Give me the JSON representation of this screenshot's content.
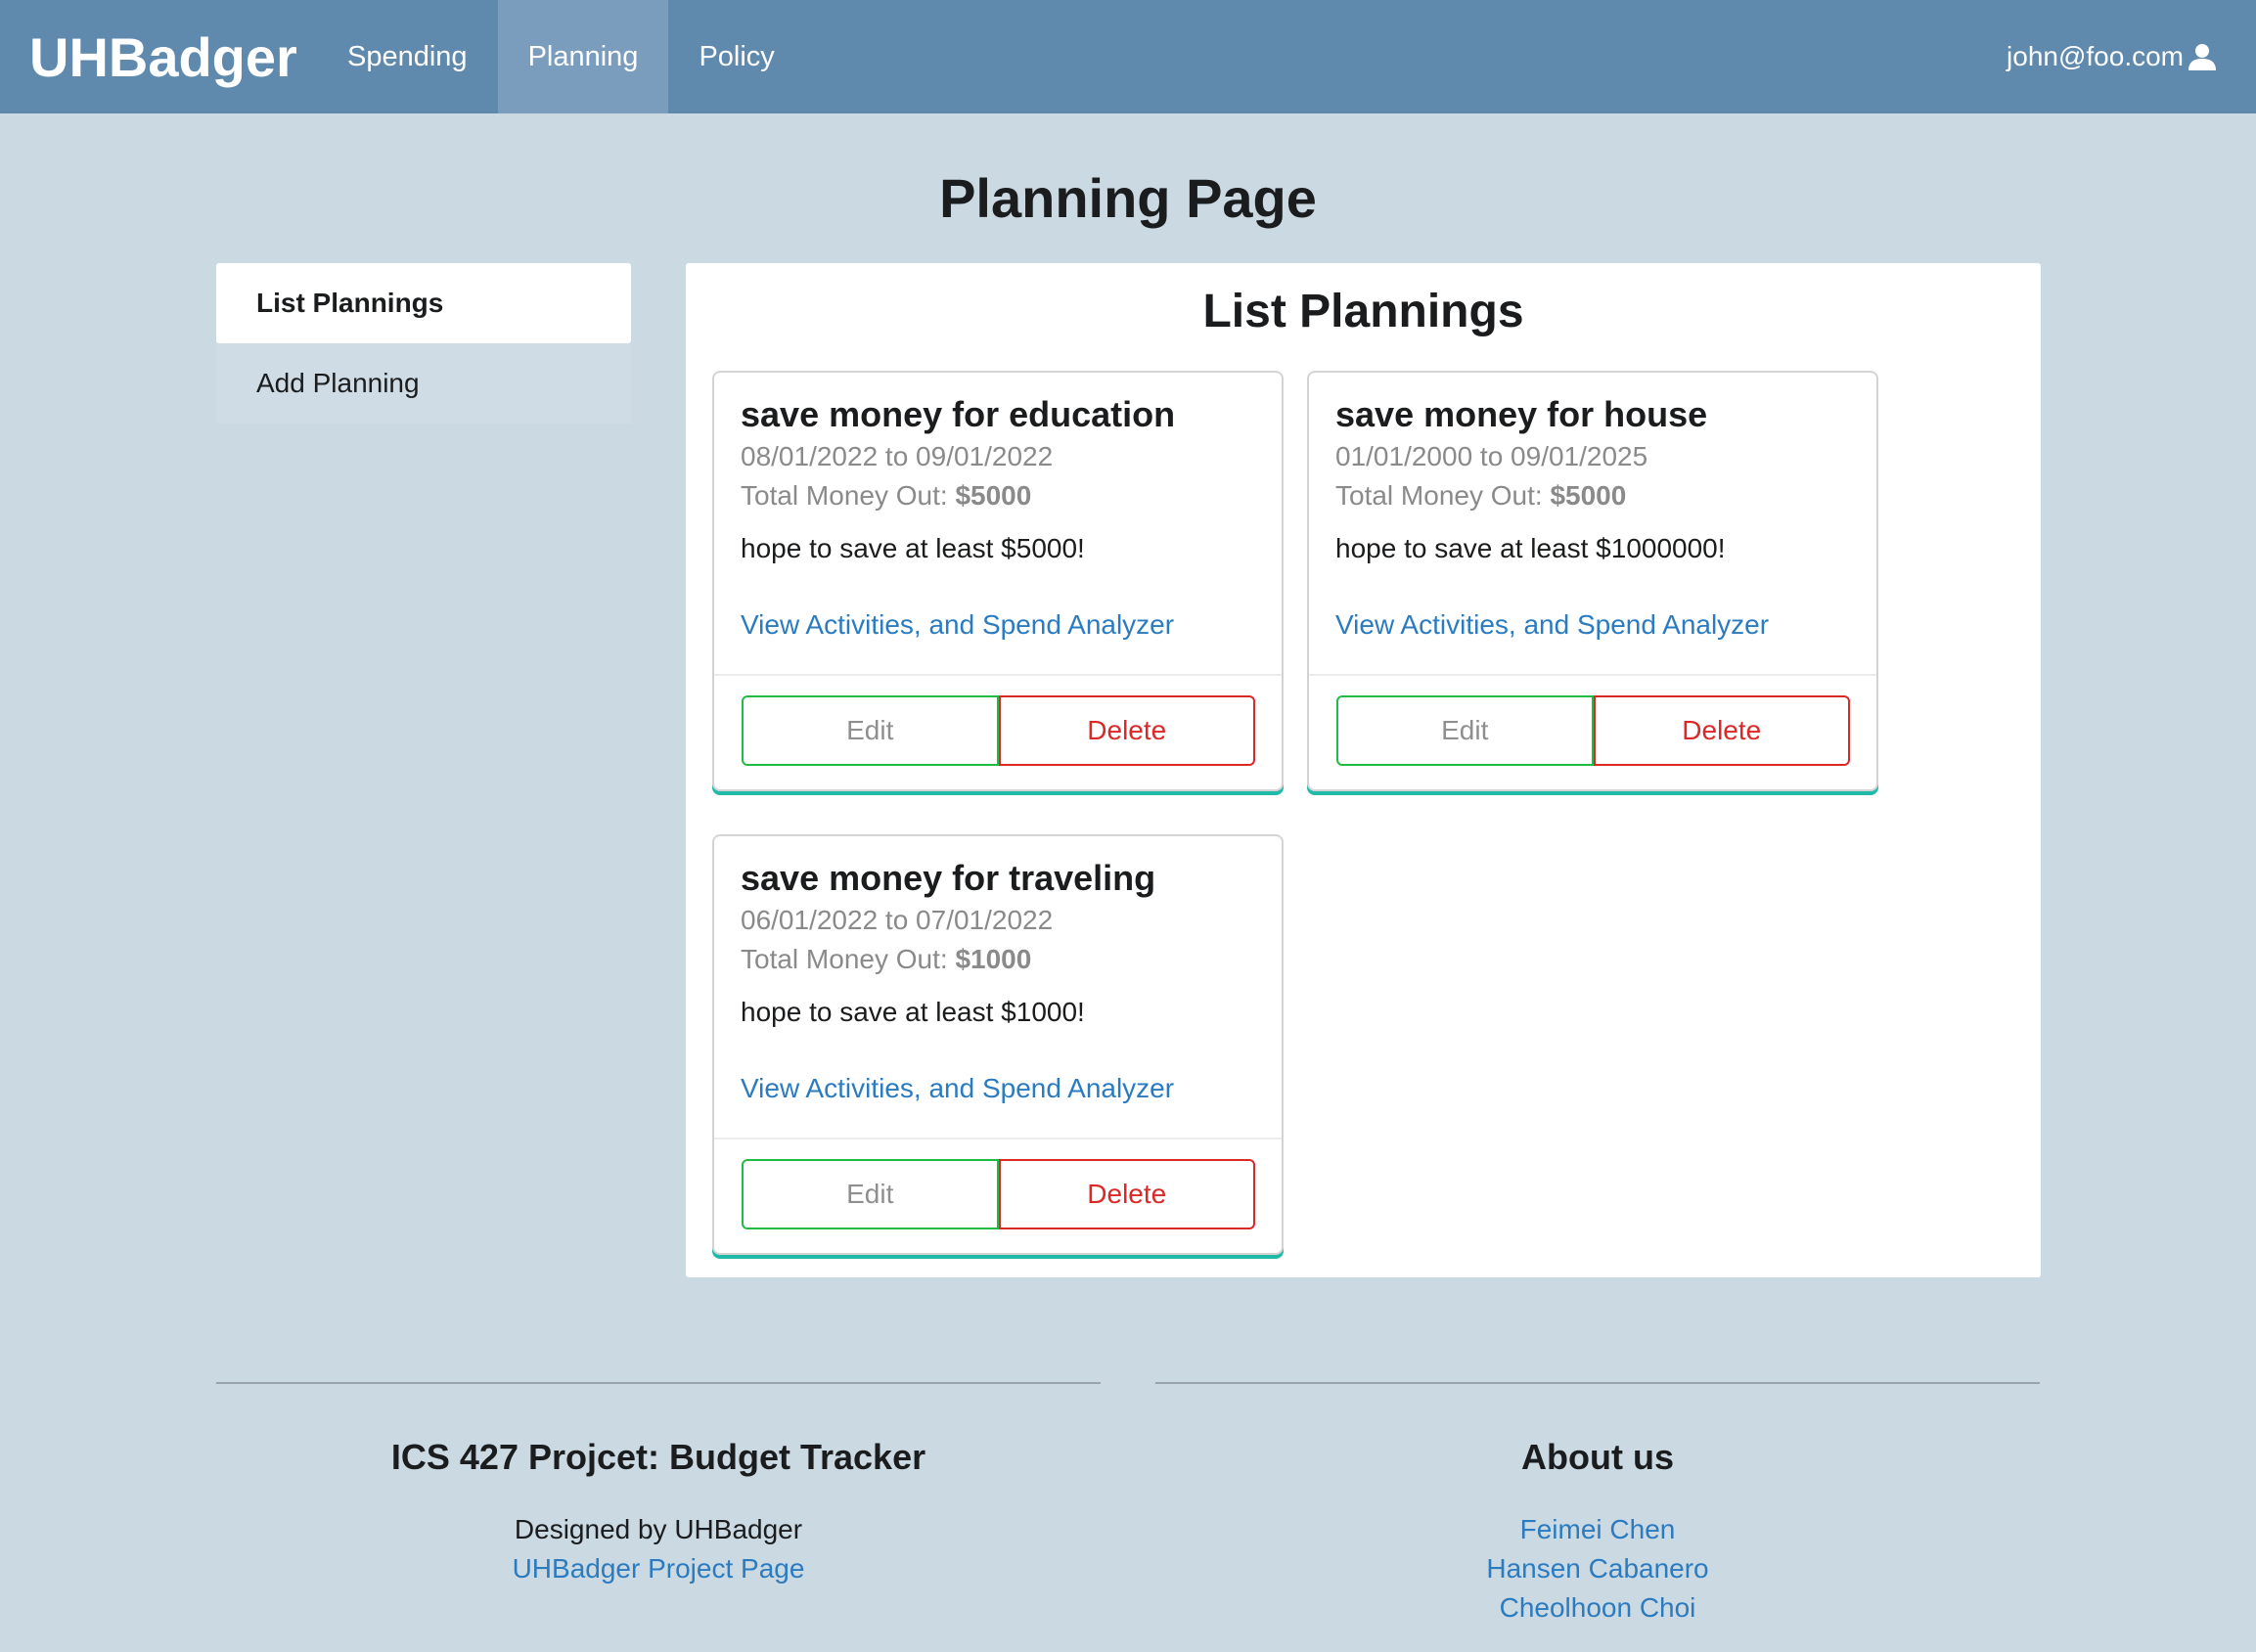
{
  "nav": {
    "brand": "UHBadger",
    "items": [
      {
        "label": "Spending"
      },
      {
        "label": "Planning"
      },
      {
        "label": "Policy"
      }
    ],
    "user": "john@foo.com"
  },
  "page_title": "Planning Page",
  "sidebar": {
    "items": [
      {
        "label": "List Plannings"
      },
      {
        "label": "Add Planning"
      }
    ]
  },
  "main": {
    "title": "List Plannings",
    "cards": [
      {
        "header": "save money for education",
        "dates": "08/01/2022 to 09/01/2022",
        "money_label": "Total Money Out: ",
        "money_value": "$5000",
        "description": "hope to save at least $5000!",
        "link": "View Activities, and Spend Analyzer",
        "edit": "Edit",
        "delete": "Delete"
      },
      {
        "header": "save money for house",
        "dates": "01/01/2000 to 09/01/2025",
        "money_label": "Total Money Out: ",
        "money_value": "$5000",
        "description": "hope to save at least $1000000!",
        "link": "View Activities, and Spend Analyzer",
        "edit": "Edit",
        "delete": "Delete"
      },
      {
        "header": "save money for traveling",
        "dates": "06/01/2022 to 07/01/2022",
        "money_label": "Total Money Out: ",
        "money_value": "$1000",
        "description": "hope to save at least $1000!",
        "link": "View Activities, and Spend Analyzer",
        "edit": "Edit",
        "delete": "Delete"
      }
    ]
  },
  "footer": {
    "left": {
      "title": "ICS 427 Projcet: Budget Tracker",
      "designed_by": "Designed by UHBadger",
      "link": "UHBadger Project Page"
    },
    "right": {
      "title": "About us",
      "members": [
        "Feimei Chen",
        "Hansen Cabanero",
        "Cheolhoon Choi"
      ]
    }
  }
}
